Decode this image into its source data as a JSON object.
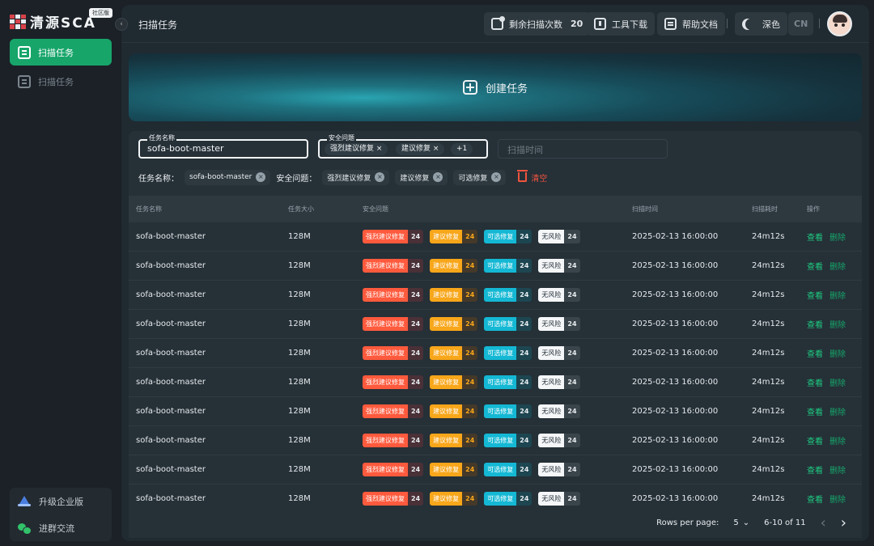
{
  "app": {
    "logo_text": "清源SCA",
    "edition": "社区版",
    "collapse_icon": "chevron-left-icon"
  },
  "sidebar": {
    "items": [
      {
        "label": "扫描任务",
        "active": true
      },
      {
        "label": "扫描任务",
        "active": false
      }
    ],
    "bottom": [
      {
        "label": "升级企业版",
        "icon": "upgrade-icon"
      },
      {
        "label": "进群交流",
        "icon": "wechat-icon"
      }
    ]
  },
  "topbar": {
    "title": "扫描任务",
    "remaining_label": "剩余扫描次数",
    "remaining_count": "20",
    "tool_download": "工具下载",
    "help_docs": "帮助文档",
    "theme": "深色",
    "language": "CN"
  },
  "hero": {
    "create_label": "创建任务"
  },
  "filters": {
    "task_name": {
      "label": "任务名称",
      "value": "sofa-boot-master"
    },
    "security": {
      "label": "安全问题",
      "chips": [
        "强烈建议修复",
        "建议修复"
      ],
      "more": "+1"
    },
    "scan_time": {
      "placeholder": "扫描时间"
    },
    "active": {
      "task_label": "任务名称：",
      "task_value": "sofa-boot-master",
      "security_label": "安全问题：",
      "chips": [
        "强烈建议修复",
        "建议修复",
        "可选修复"
      ],
      "clear": "清空"
    }
  },
  "table": {
    "headers": [
      "任务名称",
      "任务大小",
      "安全问题",
      "扫描时间",
      "扫描耗时",
      "操作"
    ],
    "badge_labels": [
      "强烈建议修复",
      "建议修复",
      "可选修复",
      "无风险"
    ],
    "actions": {
      "view": "查看",
      "delete": "删除"
    },
    "rows": [
      {
        "name": "sofa-boot-master",
        "size": "128M",
        "issues": [
          "24",
          "24",
          "24",
          "24"
        ],
        "time": "2025-02-13 16:00:00",
        "duration": "24m12s"
      },
      {
        "name": "sofa-boot-master",
        "size": "128M",
        "issues": [
          "24",
          "24",
          "24",
          "24"
        ],
        "time": "2025-02-13 16:00:00",
        "duration": "24m12s"
      },
      {
        "name": "sofa-boot-master",
        "size": "128M",
        "issues": [
          "24",
          "24",
          "24",
          "24"
        ],
        "time": "2025-02-13 16:00:00",
        "duration": "24m12s"
      },
      {
        "name": "sofa-boot-master",
        "size": "128M",
        "issues": [
          "24",
          "24",
          "24",
          "24"
        ],
        "time": "2025-02-13 16:00:00",
        "duration": "24m12s"
      },
      {
        "name": "sofa-boot-master",
        "size": "128M",
        "issues": [
          "24",
          "24",
          "24",
          "24"
        ],
        "time": "2025-02-13 16:00:00",
        "duration": "24m12s"
      },
      {
        "name": "sofa-boot-master",
        "size": "128M",
        "issues": [
          "24",
          "24",
          "24",
          "24"
        ],
        "time": "2025-02-13 16:00:00",
        "duration": "24m12s"
      },
      {
        "name": "sofa-boot-master",
        "size": "128M",
        "issues": [
          "24",
          "24",
          "24",
          "24"
        ],
        "time": "2025-02-13 16:00:00",
        "duration": "24m12s"
      },
      {
        "name": "sofa-boot-master",
        "size": "128M",
        "issues": [
          "24",
          "24",
          "24",
          "24"
        ],
        "time": "2025-02-13 16:00:00",
        "duration": "24m12s"
      },
      {
        "name": "sofa-boot-master",
        "size": "128M",
        "issues": [
          "24",
          "24",
          "24",
          "24"
        ],
        "time": "2025-02-13 16:00:00",
        "duration": "24m12s"
      },
      {
        "name": "sofa-boot-master",
        "size": "128M",
        "issues": [
          "24",
          "24",
          "24",
          "24"
        ],
        "time": "2025-02-13 16:00:00",
        "duration": "24m12s"
      }
    ]
  },
  "pagination": {
    "rows_per_page_label": "Rows per page:",
    "rows_per_page": "5",
    "range": "6-10 of 11"
  },
  "colors": {
    "accent": "#17a56a",
    "danger": "#ff5a3d",
    "warning": "#f8a61a",
    "info": "#14b8d4"
  }
}
